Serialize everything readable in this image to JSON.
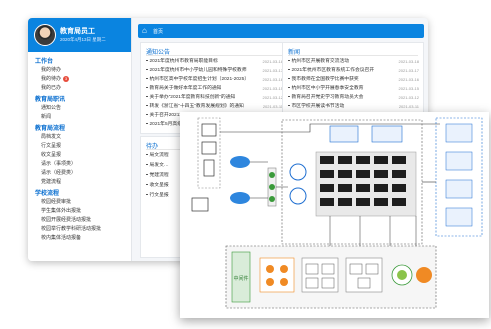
{
  "user": {
    "name": "教育局员工",
    "date": "2020年4月13日 星期二"
  },
  "sidebar": {
    "sections": [
      {
        "title": "工作台",
        "items": [
          "我的待办",
          "我的待办",
          "我的已办"
        ]
      },
      {
        "title": "教育局职讯",
        "items": [
          "通知公告",
          "新闻"
        ]
      },
      {
        "title": "教育局流程",
        "items": [
          "局档发文",
          "行文呈报",
          "收文呈报",
          "请示（事项类）",
          "请示（经费类）",
          "党建流程"
        ]
      },
      {
        "title": "学校流程",
        "items": [
          "校园经费审批",
          "学生集体外出报批",
          "校园开展经费活动报批",
          "校园举行教学科研活动报批",
          "校内集体活动报备"
        ]
      }
    ],
    "badge": "3"
  },
  "main": {
    "home_label": "首页"
  },
  "notices": {
    "title": "通知公告",
    "rows": [
      {
        "text": "2021年度杭州市教育局职能目标",
        "date": "2021-03-18"
      },
      {
        "text": "2021年度杭州市中小学幼儿园和特殊学校教师",
        "date": "2021-03-17"
      },
      {
        "text": "杭州市区高中学校年度招生计划（2021-2025）",
        "date": "2021-03-16"
      },
      {
        "text": "教育局关于做好本年度工作的通知",
        "date": "2021-03-15"
      },
      {
        "text": "关于举办“2021年度教育科技创新”的通知",
        "date": "2021-03-12"
      },
      {
        "text": "转发《浙江省“十四五”教育发展规划》的通知",
        "date": "2021-03-11"
      },
      {
        "text": "关于召开2021年第一季度工作部署会议的通知",
        "date": "2021-03-10"
      },
      {
        "text": "2021年5月高级教师职称评审相关通知",
        "date": "2021-03-09"
      }
    ]
  },
  "news": {
    "title": "新闻",
    "rows": [
      {
        "text": "杭州市区开展教育交流活动",
        "date": "2021-03-18"
      },
      {
        "text": "2021年杭州市区教育系统工作会议召开",
        "date": "2021-03-17"
      },
      {
        "text": "我市教师在全国教学比赛中获奖",
        "date": "2021-03-16"
      },
      {
        "text": "杭州市区中小学开展春季安全教育",
        "date": "2021-03-15"
      },
      {
        "text": "教育局召开党史学习教育动员大会",
        "date": "2021-03-12"
      },
      {
        "text": "市区学校开展读书节活动",
        "date": "2021-03-11"
      },
      {
        "text": "杭州市区第二批名校集团化办学",
        "date": "2021-03-10"
      }
    ]
  },
  "todo": {
    "title": "待办",
    "rows": [
      "局文流程",
      "局发文…",
      "党建流程",
      "收文呈报",
      "行文呈报"
    ]
  },
  "diagram": {
    "zone_label": "中间件",
    "accent": "#1f6fd1",
    "orange": "#f08a24",
    "green": "#3a9a3a"
  }
}
